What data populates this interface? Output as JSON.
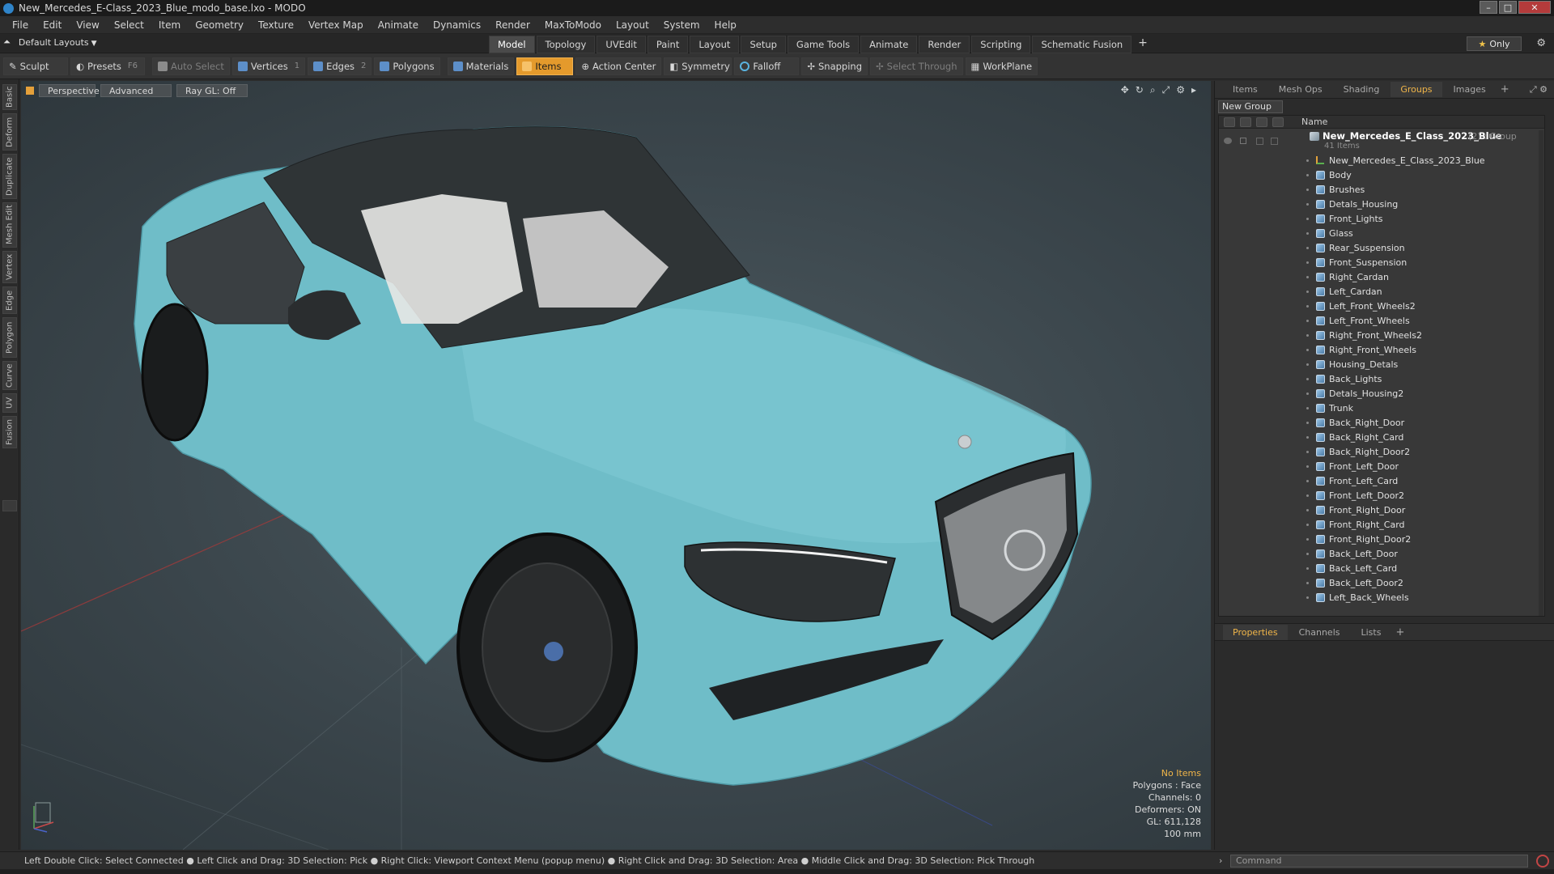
{
  "window": {
    "title": "New_Mercedes_E-Class_2023_Blue_modo_base.lxo - MODO",
    "minimize": "–",
    "maximize": "□",
    "close": "✕"
  },
  "menu": [
    "File",
    "Edit",
    "View",
    "Select",
    "Item",
    "Geometry",
    "Texture",
    "Vertex Map",
    "Animate",
    "Dynamics",
    "Render",
    "MaxToModo",
    "Layout",
    "System",
    "Help"
  ],
  "layout": {
    "dropdown": "Default Layouts",
    "tabs": [
      "Model",
      "Topology",
      "UVEdit",
      "Paint",
      "Layout",
      "Setup",
      "Game Tools",
      "Animate",
      "Render",
      "Scripting",
      "Schematic Fusion"
    ],
    "active_tab": "Model",
    "only_label": "Only"
  },
  "toolbar": {
    "sculpt": "Sculpt",
    "presets": "Presets",
    "presets_key": "F6",
    "auto_select": "Auto Select",
    "vertices": "Vertices",
    "vertices_key": "1",
    "edges": "Edges",
    "edges_key": "2",
    "polygons": "Polygons",
    "materials": "Materials",
    "items": "Items",
    "action_center": "Action Center",
    "symmetry": "Symmetry",
    "falloff": "Falloff",
    "snapping": "Snapping",
    "select_through": "Select Through",
    "workplane": "WorkPlane"
  },
  "left_tabs": [
    "Basic",
    "Deform",
    "Duplicate",
    "Mesh Edit",
    "Vertex",
    "Edge",
    "Polygon",
    "Curve",
    "UV",
    "Fusion"
  ],
  "viewport": {
    "view": "Perspective",
    "shading": "Advanced",
    "raygl": "Ray GL: Off",
    "info": {
      "items": "No Items",
      "polygons": "Polygons : Face",
      "channels": "Channels: 0",
      "deformers": "Deformers: ON",
      "gl": "GL: 611,128",
      "scale": "100 mm"
    },
    "colors": {
      "car_body": "#6fbdc8",
      "background": "#3b464c"
    }
  },
  "right_panel": {
    "tabs": [
      "Items",
      "Mesh Ops",
      "Shading",
      "Groups",
      "Images"
    ],
    "active_tab": "Groups",
    "new_group": "New Group",
    "column_name": "Name",
    "group": {
      "name": "New_Mercedes_E_Class_2023_Blue",
      "suffix": "(2) : Group",
      "count": "41 Items"
    },
    "locator": "New_Mercedes_E_Class_2023_Blue",
    "items": [
      "Body",
      "Brushes",
      "Detals_Housing",
      "Front_Lights",
      "Glass",
      "Rear_Suspension",
      "Front_Suspension",
      "Right_Cardan",
      "Left_Cardan",
      "Left_Front_Wheels2",
      "Left_Front_Wheels",
      "Right_Front_Wheels2",
      "Right_Front_Wheels",
      "Housing_Detals",
      "Back_Lights",
      "Detals_Housing2",
      "Trunk",
      "Back_Right_Door",
      "Back_Right_Card",
      "Back_Right_Door2",
      "Front_Left_Door",
      "Front_Left_Card",
      "Front_Left_Door2",
      "Front_Right_Door",
      "Front_Right_Card",
      "Front_Right_Door2",
      "Back_Left_Door",
      "Back_Left_Card",
      "Back_Left_Door2",
      "Left_Back_Wheels"
    ],
    "lower_tabs": [
      "Properties",
      "Channels",
      "Lists"
    ],
    "lower_active": "Properties"
  },
  "status": "Left Double Click: Select Connected ● Left Click and Drag: 3D Selection: Pick ● Right Click: Viewport Context Menu (popup menu) ● Right Click and Drag: 3D Selection: Area ● Middle Click and Drag: 3D Selection: Pick Through",
  "command_placeholder": "Command"
}
